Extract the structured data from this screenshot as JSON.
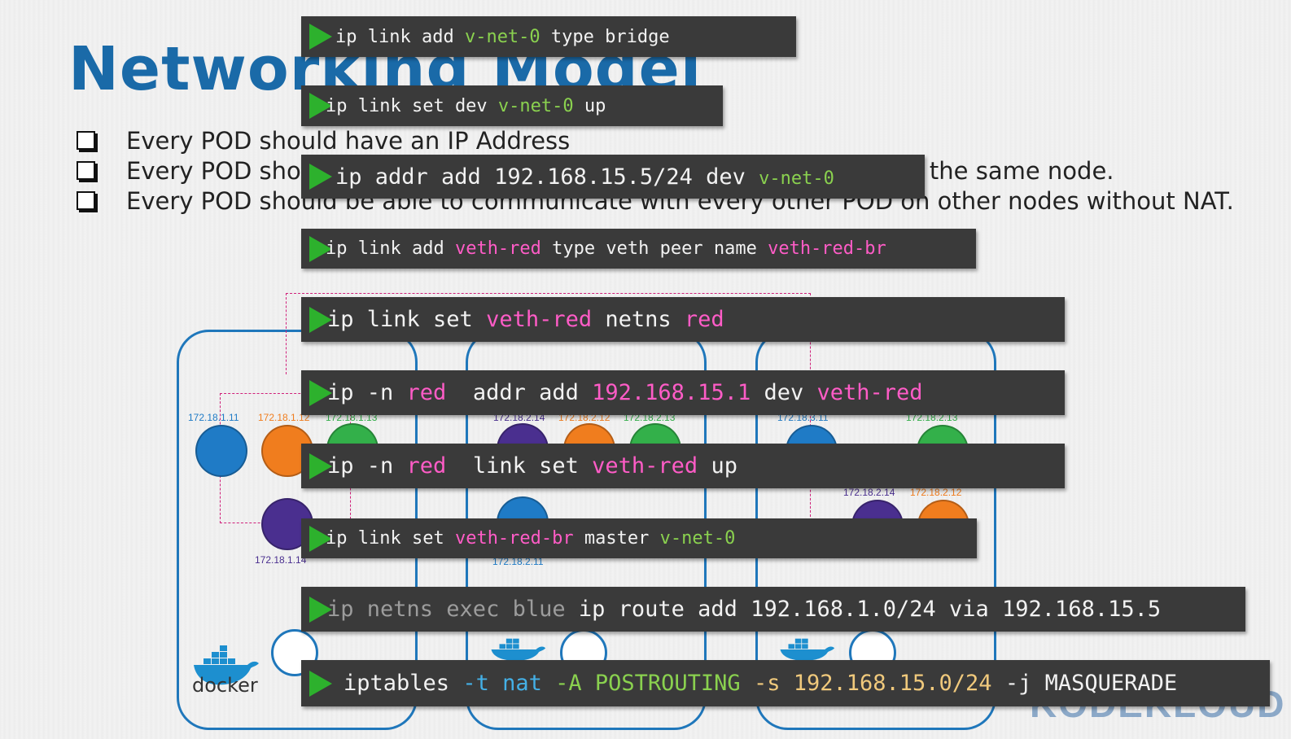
{
  "slide": {
    "title": "Networking Model",
    "bullets": [
      "Every POD should have an IP Address",
      "Every POD should be able to communicate with every other POD in the same node.",
      "Every POD should be able to communicate with every other POD on other nodes without NAT."
    ],
    "brand_watermark": "KODEKLOUD"
  },
  "diagram": {
    "runtime_label": "docker",
    "pod_ips": {
      "n1_a": "172.18.1.11",
      "n1_b": "172.18.1.12",
      "n1_c": "172.18.1.13",
      "n1_d": "172.18.1.14",
      "n2_a": "172.18.2.14",
      "n2_b": "172.18.2.12",
      "n2_c": "172.18.2.13",
      "n2_d": "172.18.2.11",
      "n3_a": "172.18.3.11",
      "n3_b": "172.18.2.13",
      "n3_c": "172.18.2.14",
      "n3_d": "172.18.2.12"
    },
    "colors": {
      "blue": "#1f7bc6",
      "orange": "#f07d1e",
      "green": "#33b04a",
      "purple": "#4a2f8f",
      "node_border": "#1f77bb"
    }
  },
  "commands": [
    {
      "parts": [
        "ip link add ",
        "v-net-0",
        " type bridge"
      ]
    },
    {
      "parts": [
        "ip link set dev ",
        "v-net-0",
        " up"
      ]
    },
    {
      "parts": [
        "ip addr add 192.168.15.5/24 dev ",
        "v-net-0"
      ]
    },
    {
      "parts": [
        "ip link add ",
        "veth-red",
        " type veth peer name ",
        "veth-red-br"
      ]
    },
    {
      "parts": [
        "ip link set ",
        "veth-red",
        " netns ",
        "red"
      ]
    },
    {
      "parts": [
        "ip -n ",
        "red",
        "  addr add ",
        "192.168.15.1",
        " dev ",
        "veth-red"
      ]
    },
    {
      "parts": [
        "ip -n ",
        "red",
        "  link set ",
        "veth-red",
        " up"
      ]
    },
    {
      "parts": [
        "ip link set ",
        "veth-red-br",
        " master ",
        "v-net-0"
      ]
    },
    {
      "parts": [
        "ip netns exec blue",
        " ip route add 192.168.1.0/24 via 192.168.15.5"
      ]
    },
    {
      "parts": [
        "iptables ",
        "-t nat",
        " -A POSTROUTING",
        " -s ",
        "192.168.15.0/24",
        " -j MASQUERADE"
      ]
    }
  ],
  "theme": {
    "play_icon": "green-play-triangle",
    "bar_bg": "#3a3a3a",
    "accent_green": "#8ad14f",
    "accent_pink": "#ff5cc7",
    "accent_cyan": "#44b0e6",
    "accent_yellow": "#f0c97c"
  }
}
